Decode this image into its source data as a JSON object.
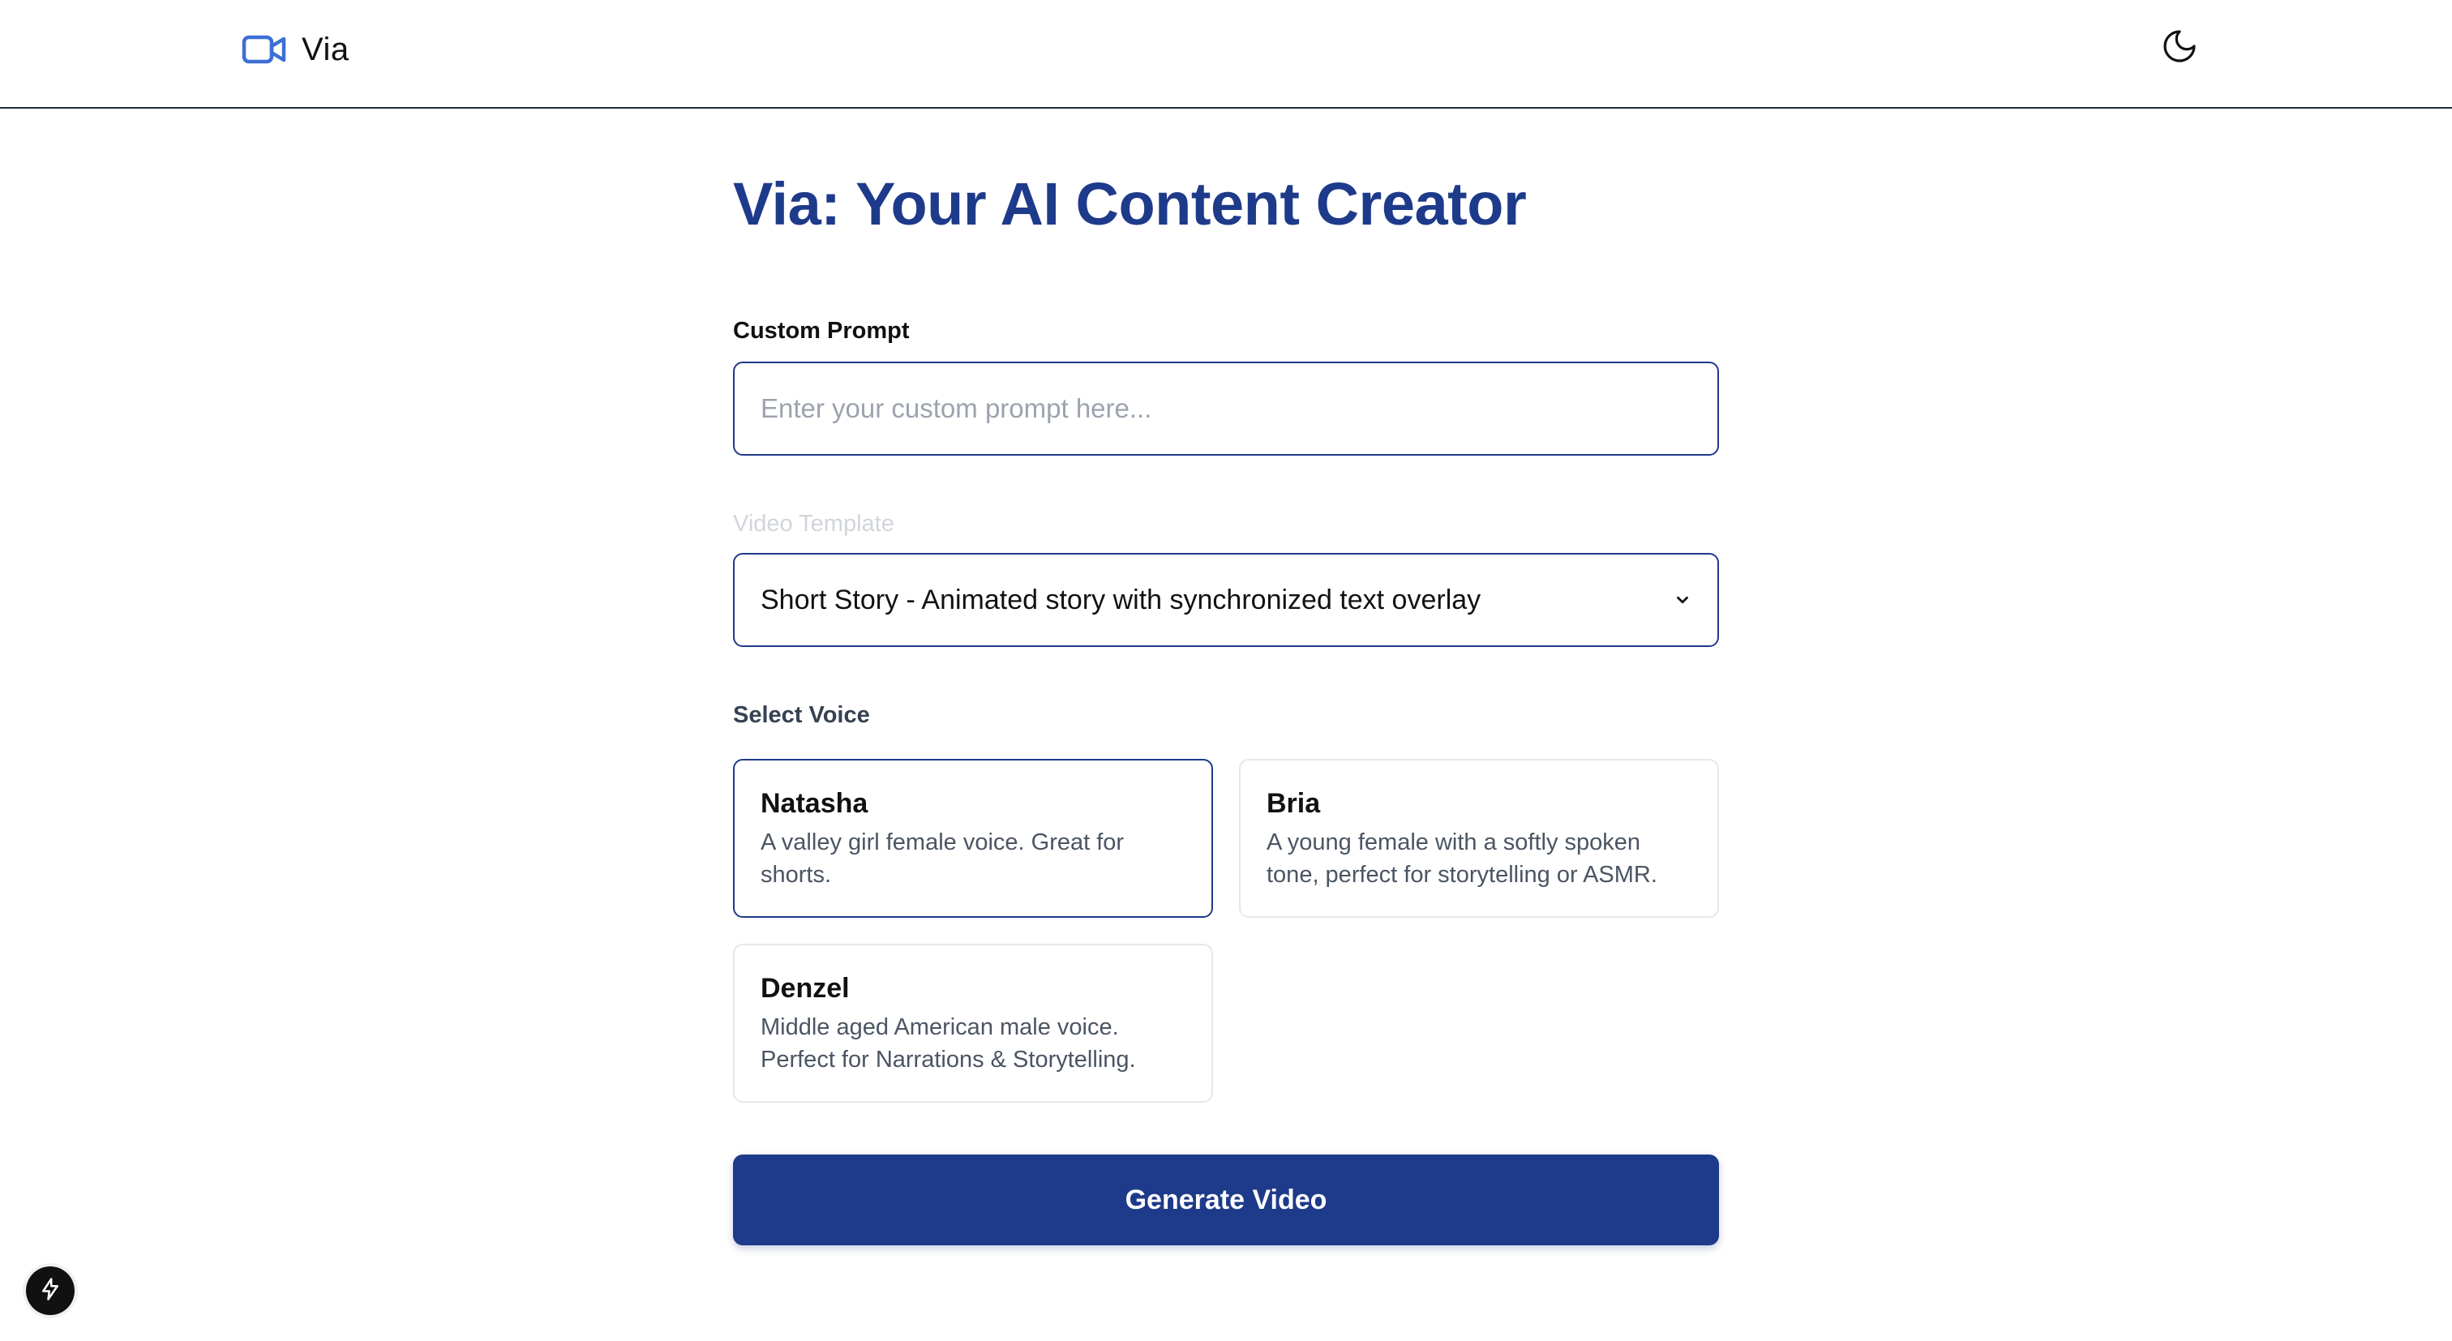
{
  "header": {
    "brand_name": "Via",
    "brand_icon": "video-camera-icon",
    "theme_toggle_icon": "moon-icon"
  },
  "main": {
    "title": "Via: Your AI Content Creator",
    "custom_prompt": {
      "label": "Custom Prompt",
      "value": "",
      "placeholder": "Enter your custom prompt here..."
    },
    "video_template": {
      "label": "Video Template",
      "selected": "Short Story - Animated story with synchronized text overlay"
    },
    "voice": {
      "label": "Select Voice",
      "selected": "Natasha",
      "options": [
        {
          "name": "Natasha",
          "description": "A valley girl female voice. Great for shorts."
        },
        {
          "name": "Bria",
          "description": "A young female with a softly spoken tone, perfect for storytelling or ASMR."
        },
        {
          "name": "Denzel",
          "description": "Middle aged American male voice. Perfect for Narrations & Storytelling."
        }
      ]
    },
    "generate_button": "Generate Video"
  },
  "dev_badge_icon": "lightning-bolt-icon",
  "colors": {
    "accent": "#1e3a8a",
    "brand_icon": "#3b6fd4",
    "border": "#e5e7eb",
    "muted_label": "#d1d5db"
  }
}
